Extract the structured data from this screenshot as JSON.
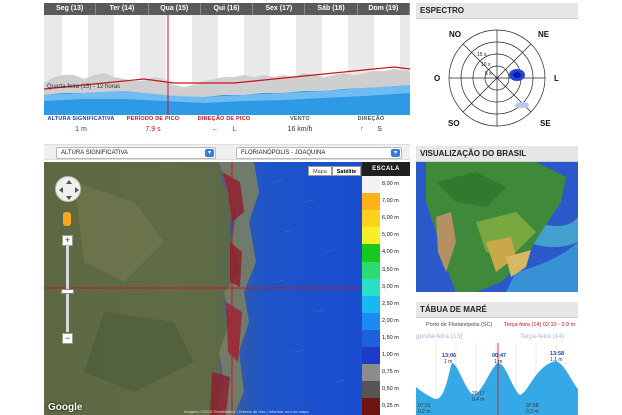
{
  "forecast": {
    "days": [
      "Seg (13)",
      "Ter (14)",
      "Qua (15)",
      "Qui (16)",
      "Sex (17)",
      "Sáb (18)",
      "Dom (19)"
    ],
    "series_label": "Quarta-feira (15) - 12 horas",
    "metrics": [
      {
        "label": "ALTURA SIGNIFICATIVA",
        "value": "1 m",
        "color": "#1a3fb0"
      },
      {
        "label": "PERÍODO DE PICO",
        "value": "7.9 s",
        "color": "#c8141e"
      },
      {
        "label": "DIREÇÃO DE PICO",
        "value": "L",
        "color": "#c8141e"
      },
      {
        "label": "VENTO",
        "value": "16 km/h",
        "color": "#555555"
      },
      {
        "label": "DIREÇÃO",
        "value": "S",
        "color": "#555555"
      }
    ],
    "direction_arrow": "←",
    "wind_arrow": "↑"
  },
  "selectors": {
    "variable": "ALTURA SIGNIFICATIVA",
    "location": "FLORIANÓPOLIS - JOAQUINA"
  },
  "map": {
    "type_buttons": [
      "Mapa",
      "Satélite"
    ],
    "scale_title": "ESCALA",
    "scale_levels": [
      {
        "label": "8,00 m",
        "color": "#f2f2f2"
      },
      {
        "label": "7,00 m",
        "color": "#ffb21a"
      },
      {
        "label": "6,00 m",
        "color": "#ffd21e"
      },
      {
        "label": "5,00 m",
        "color": "#f5f028"
      },
      {
        "label": "4,00 m",
        "color": "#17c81e"
      },
      {
        "label": "3,50 m",
        "color": "#2ddc6e"
      },
      {
        "label": "3,00 m",
        "color": "#29e0c8"
      },
      {
        "label": "2,50 m",
        "color": "#1ab8f0"
      },
      {
        "label": "2,00 m",
        "color": "#1a8cf0"
      },
      {
        "label": "1,50 m",
        "color": "#1e5fdc"
      },
      {
        "label": "1,00 m",
        "color": "#1a3cc8"
      },
      {
        "label": "0,75 m",
        "color": "#8c8c8c"
      },
      {
        "label": "0,50 m",
        "color": "#555555"
      },
      {
        "label": "0,25 m",
        "color": "#6e1414"
      }
    ],
    "google": "Google",
    "attribution": "Imagens ©2015 TerraMetrics | Termos de Uso | Informar erro no mapa"
  },
  "spectrum": {
    "title": "ESPECTRO",
    "directions": [
      "NO",
      "NE",
      "O",
      "L",
      "SO",
      "SE"
    ],
    "ring_labels": [
      "15 s",
      "10 s",
      "5 s"
    ]
  },
  "brazil": {
    "title": "VISUALIZAÇÃO DO BRASIL"
  },
  "tide": {
    "title": "TÁBUA DE MARÉ",
    "port": "Porto de Florianópolis (SC)",
    "current": "Terça-feira (14) 02:10 - 0.9 m",
    "day_left": "gunda-feira (13)",
    "day_right": "Terça-feira (14)",
    "peaks": [
      {
        "time": "13:06",
        "height": "1 m"
      },
      {
        "time": "00:47",
        "height": "1 m"
      },
      {
        "time": "13:58",
        "height": "1.1 m"
      }
    ],
    "troughs": [
      {
        "time": "07:31",
        "height": "0.2 m"
      },
      {
        "time": "20:17",
        "height": "0.4 m"
      },
      {
        "time": "07:58",
        "height": "0.2 m"
      }
    ]
  }
}
